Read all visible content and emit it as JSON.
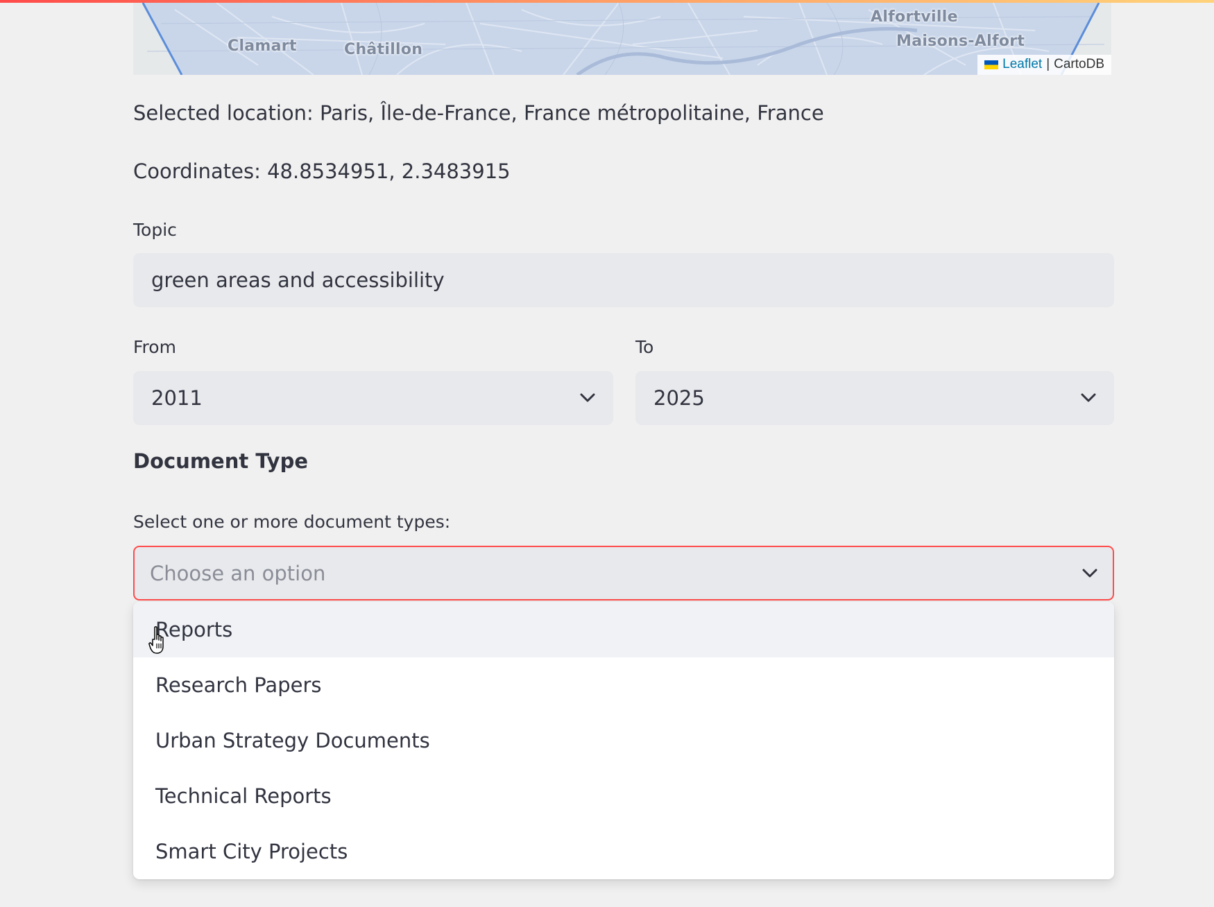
{
  "map": {
    "labels": [
      "Clamart",
      "Châtillon",
      "Alfortville",
      "Maisons-Alfort"
    ],
    "attribution_leaflet": "Leaflet",
    "attribution_separator": "|",
    "attribution_carto": "CartoDB"
  },
  "location": {
    "selected_text": "Selected location: Paris, Île-de-France, France métropolitaine, France",
    "coordinates_text": "Coordinates: 48.8534951, 2.3483915"
  },
  "topic": {
    "label": "Topic",
    "value": "green areas and accessibility"
  },
  "from": {
    "label": "From",
    "value": "2011"
  },
  "to": {
    "label": "To",
    "value": "2025"
  },
  "document_type": {
    "heading": "Document Type",
    "label": "Select one or more document types:",
    "placeholder": "Choose an option",
    "options": [
      "Reports",
      "Research Papers",
      "Urban Strategy Documents",
      "Technical Reports",
      "Smart City Projects"
    ],
    "hovered_option": "Reports"
  },
  "colors": {
    "accent": "#ff4b4b",
    "background": "#f0f0f0",
    "input_background": "#e8e9ec",
    "text": "#31333f",
    "map_water": "#c9d6ea",
    "boundary": "#5b8dd9"
  },
  "icons": [
    "chevron-down-icon",
    "hand-cursor-icon",
    "ukraine-flag-icon"
  ]
}
